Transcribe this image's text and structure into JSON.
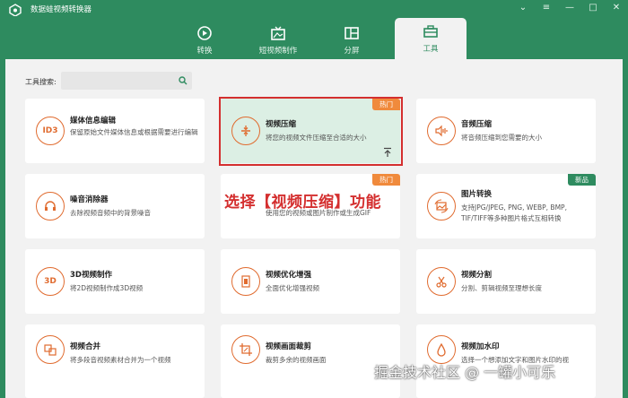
{
  "app": {
    "title": "数据蛙视频转换器"
  },
  "window_controls": [
    "chevron-down-icon",
    "menu-icon",
    "minimize-icon",
    "maximize-icon",
    "close-icon"
  ],
  "tabs": [
    {
      "label": "转换",
      "icon": "convert-icon",
      "active": false
    },
    {
      "label": "短视频制作",
      "icon": "tv-icon",
      "active": false
    },
    {
      "label": "分屏",
      "icon": "split-screen-icon",
      "active": false
    },
    {
      "label": "工具",
      "icon": "toolbox-icon",
      "active": true
    }
  ],
  "search": {
    "label": "工具搜索:",
    "value": ""
  },
  "cards": [
    {
      "title": "媒体信息编辑",
      "desc": "保留原始文件媒体信息或根据需要进行编辑",
      "icon": "id3-icon",
      "icon_text": "ID3",
      "badge": ""
    },
    {
      "title": "视频压缩",
      "desc": "将您的视频文件压缩至合适的大小",
      "icon": "compress-icon",
      "icon_text": "",
      "badge": "热门"
    },
    {
      "title": "音频压缩",
      "desc": "将音频压缩到您需要的大小",
      "icon": "audio-compress-icon",
      "icon_text": "",
      "badge": ""
    },
    {
      "title": "噪音消除器",
      "desc": "去除视频音频中的背景噪音",
      "icon": "headphones-icon",
      "icon_text": "",
      "badge": ""
    },
    {
      "title": "",
      "desc": "使用您的视频或图片制作或生成GIF",
      "icon": "gif-icon",
      "icon_text": "",
      "badge": "热门"
    },
    {
      "title": "图片转换",
      "desc": "支持JPG/JPEG, PNG, WEBP, BMP, TIF/TIFF等多种图片格式互相转换",
      "icon": "image-convert-icon",
      "icon_text": "",
      "badge": "新品"
    },
    {
      "title": "3D视频制作",
      "desc": "将2D视频制作成3D视频",
      "icon": "3d-icon",
      "icon_text": "3D",
      "badge": ""
    },
    {
      "title": "视频优化增强",
      "desc": "全面优化增强视频",
      "icon": "enhance-icon",
      "icon_text": "",
      "badge": ""
    },
    {
      "title": "视频分割",
      "desc": "分割、剪辑视频至理想长度",
      "icon": "scissors-icon",
      "icon_text": "",
      "badge": ""
    },
    {
      "title": "视频合并",
      "desc": "将多段音视频素材合并为一个视频",
      "icon": "merge-icon",
      "icon_text": "",
      "badge": ""
    },
    {
      "title": "视频画面裁剪",
      "desc": "裁剪多余的视频画面",
      "icon": "crop-icon",
      "icon_text": "",
      "badge": ""
    },
    {
      "title": "视频加水印",
      "desc": "选择一个想添加文字和图片水印的视",
      "icon": "watermark-icon",
      "icon_text": "",
      "badge": ""
    }
  ],
  "overlay_caption": "选择【视频压缩】功能",
  "watermark": "掘金技术社区 @ 一罐小可乐",
  "colors": {
    "brand": "#2e8b5f",
    "accent": "#e06b2f",
    "hot": "#f08a3c",
    "highlight": "#d42f2f"
  }
}
